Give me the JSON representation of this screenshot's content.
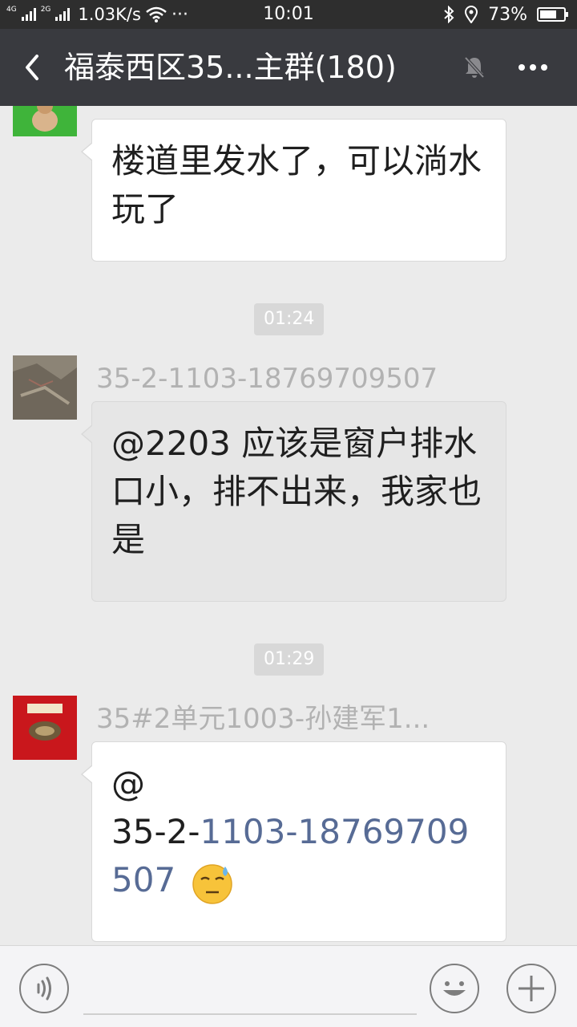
{
  "status_bar": {
    "network_1": "4G",
    "network_2": "2G",
    "speed": "1.03K/s",
    "more": "···",
    "time": "10:01",
    "battery": "73%",
    "battery_level": 0.73
  },
  "header": {
    "title": "福泰西区35...主群(180)",
    "more_icon": "more-horizontal-icon",
    "mute_icon": "bell-off-icon",
    "back_icon": "chevron-left-icon"
  },
  "messages": [
    {
      "sender": "",
      "text": "楼道里发水了，可以淌水玩了"
    },
    {
      "time": "01:24"
    },
    {
      "sender": "35-2-1103-18769709507",
      "text": "@2203 应该是窗户排水口小，排不出来，我家也是"
    },
    {
      "time": "01:29"
    },
    {
      "sender": "35#2单元1003-孙建军1...",
      "text_prefix": "@",
      "text_plain": "35-2-",
      "text_link": "1103-18769709507",
      "emoji": "sweat-smile-emoji"
    }
  ],
  "input_bar": {
    "placeholder": "",
    "voice_icon": "voice-icon",
    "emoji_icon": "smile-icon",
    "plus_icon": "plus-icon"
  },
  "colors": {
    "status_bar": "#2e2e2e",
    "title_bar": "#393a3f",
    "chat_bg": "#ebebeb",
    "link": "#576b95",
    "name": "#b2b2b2"
  }
}
